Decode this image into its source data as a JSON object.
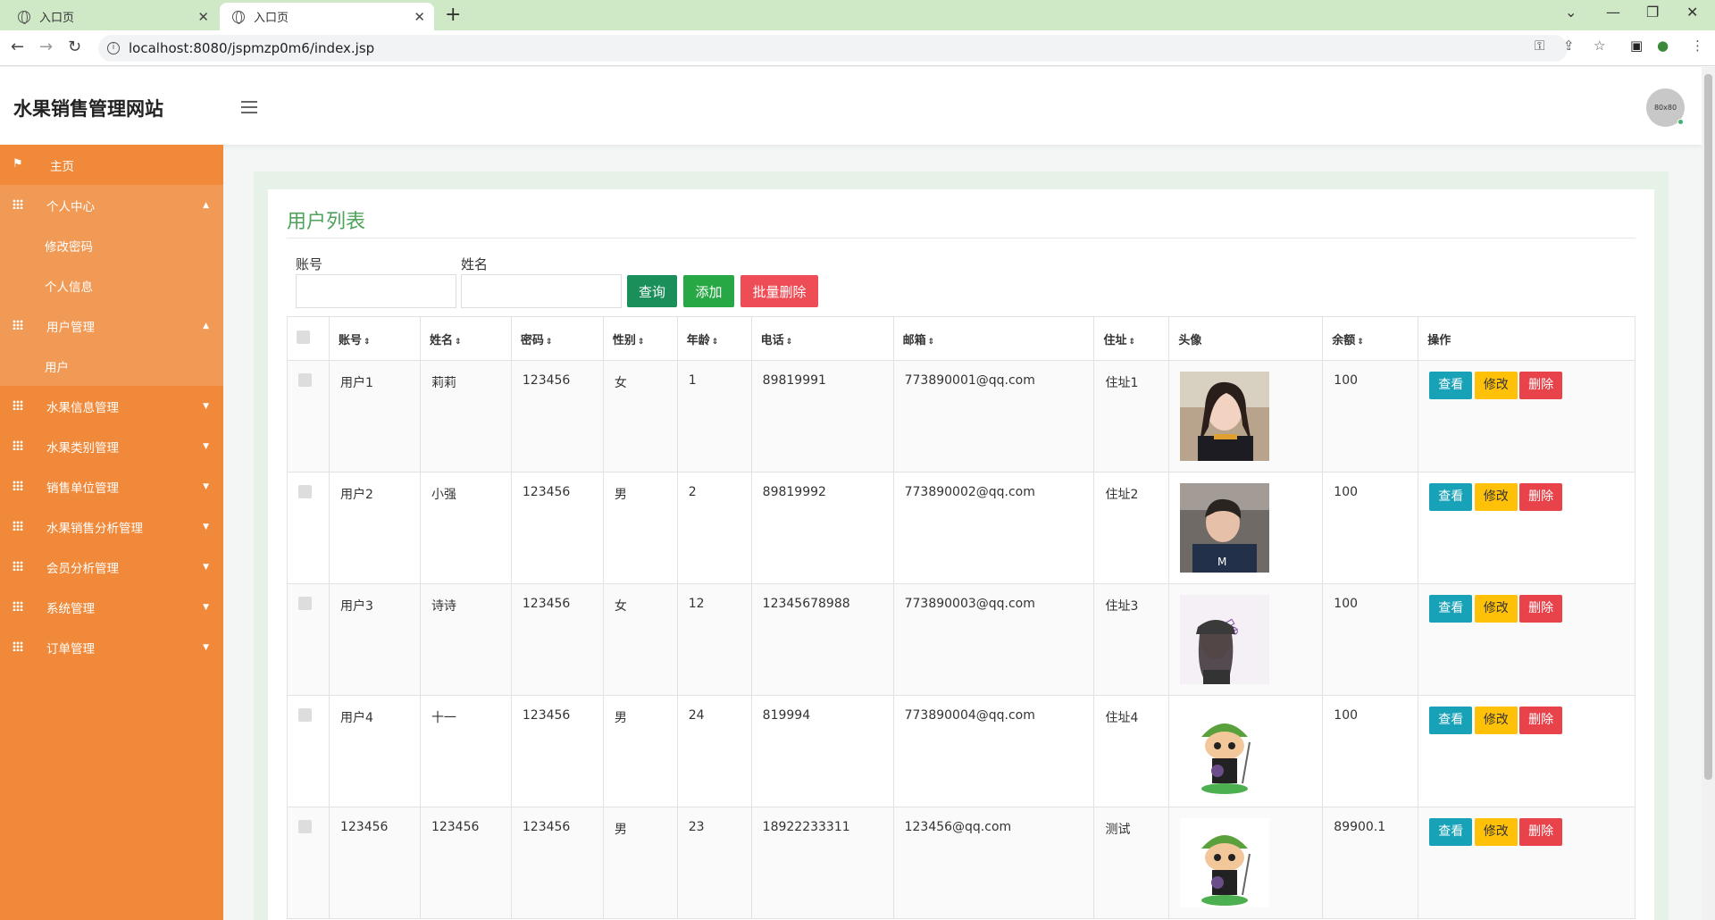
{
  "browser": {
    "tabs": [
      {
        "title": "入口页"
      },
      {
        "title": "入口页"
      }
    ],
    "url": "localhost:8080/jspmzp0m6/index.jsp"
  },
  "app": {
    "brand": "水果销售管理网站",
    "avatar_text": "80x80"
  },
  "sidebar": {
    "items": [
      {
        "label": "主页"
      },
      {
        "label": "个人中心",
        "subs": [
          "修改密码",
          "个人信息"
        ]
      },
      {
        "label": "用户管理",
        "subs": [
          "用户"
        ]
      },
      {
        "label": "水果信息管理"
      },
      {
        "label": "水果类别管理"
      },
      {
        "label": "销售单位管理"
      },
      {
        "label": "水果销售分析管理"
      },
      {
        "label": "会员分析管理"
      },
      {
        "label": "系统管理"
      },
      {
        "label": "订单管理"
      }
    ]
  },
  "main": {
    "title": "用户列表",
    "filters": [
      {
        "label": "账号",
        "value": ""
      },
      {
        "label": "姓名",
        "value": ""
      }
    ],
    "buttons": {
      "query": "查询",
      "add": "添加",
      "batch_delete": "批量删除"
    },
    "table": {
      "headers": [
        "账号",
        "姓名",
        "密码",
        "性别",
        "年龄",
        "电话",
        "邮箱",
        "住址",
        "头像",
        "余额",
        "操作"
      ],
      "action_labels": {
        "view": "查看",
        "edit": "修改",
        "delete": "删除"
      },
      "rows": [
        {
          "account": "用户1",
          "name": "莉莉",
          "password": "123456",
          "gender": "女",
          "age": "1",
          "phone": "89819991",
          "email": "773890001@qq.com",
          "address": "住址1",
          "balance": "100"
        },
        {
          "account": "用户2",
          "name": "小强",
          "password": "123456",
          "gender": "男",
          "age": "2",
          "phone": "89819992",
          "email": "773890002@qq.com",
          "address": "住址2",
          "balance": "100"
        },
        {
          "account": "用户3",
          "name": "诗诗",
          "password": "123456",
          "gender": "女",
          "age": "12",
          "phone": "12345678988",
          "email": "773890003@qq.com",
          "address": "住址3",
          "balance": "100"
        },
        {
          "account": "用户4",
          "name": "十一",
          "password": "123456",
          "gender": "男",
          "age": "24",
          "phone": "819994",
          "email": "773890004@qq.com",
          "address": "住址4",
          "balance": "100"
        },
        {
          "account": "123456",
          "name": "123456",
          "password": "123456",
          "gender": "男",
          "age": "23",
          "phone": "18922233311",
          "email": "123456@qq.com",
          "address": "测试",
          "balance": "89900.1"
        }
      ]
    }
  },
  "colors": {
    "sidebar": "#f08a3a",
    "title": "#4ea35a",
    "view": "#17a2b8",
    "edit": "#ffc107",
    "delete": "#e8434b"
  }
}
